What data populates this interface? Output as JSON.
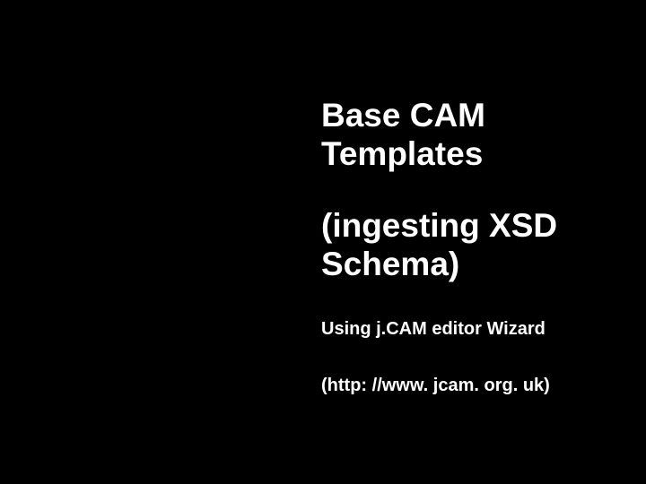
{
  "slide": {
    "title_line1": "Base CAM",
    "title_line2": "Templates",
    "subtitle_line1": "(ingesting XSD",
    "subtitle_line2": "Schema)",
    "byline": "Using j.CAM editor Wizard",
    "url": "(http: //www. jcam. org. uk)"
  }
}
